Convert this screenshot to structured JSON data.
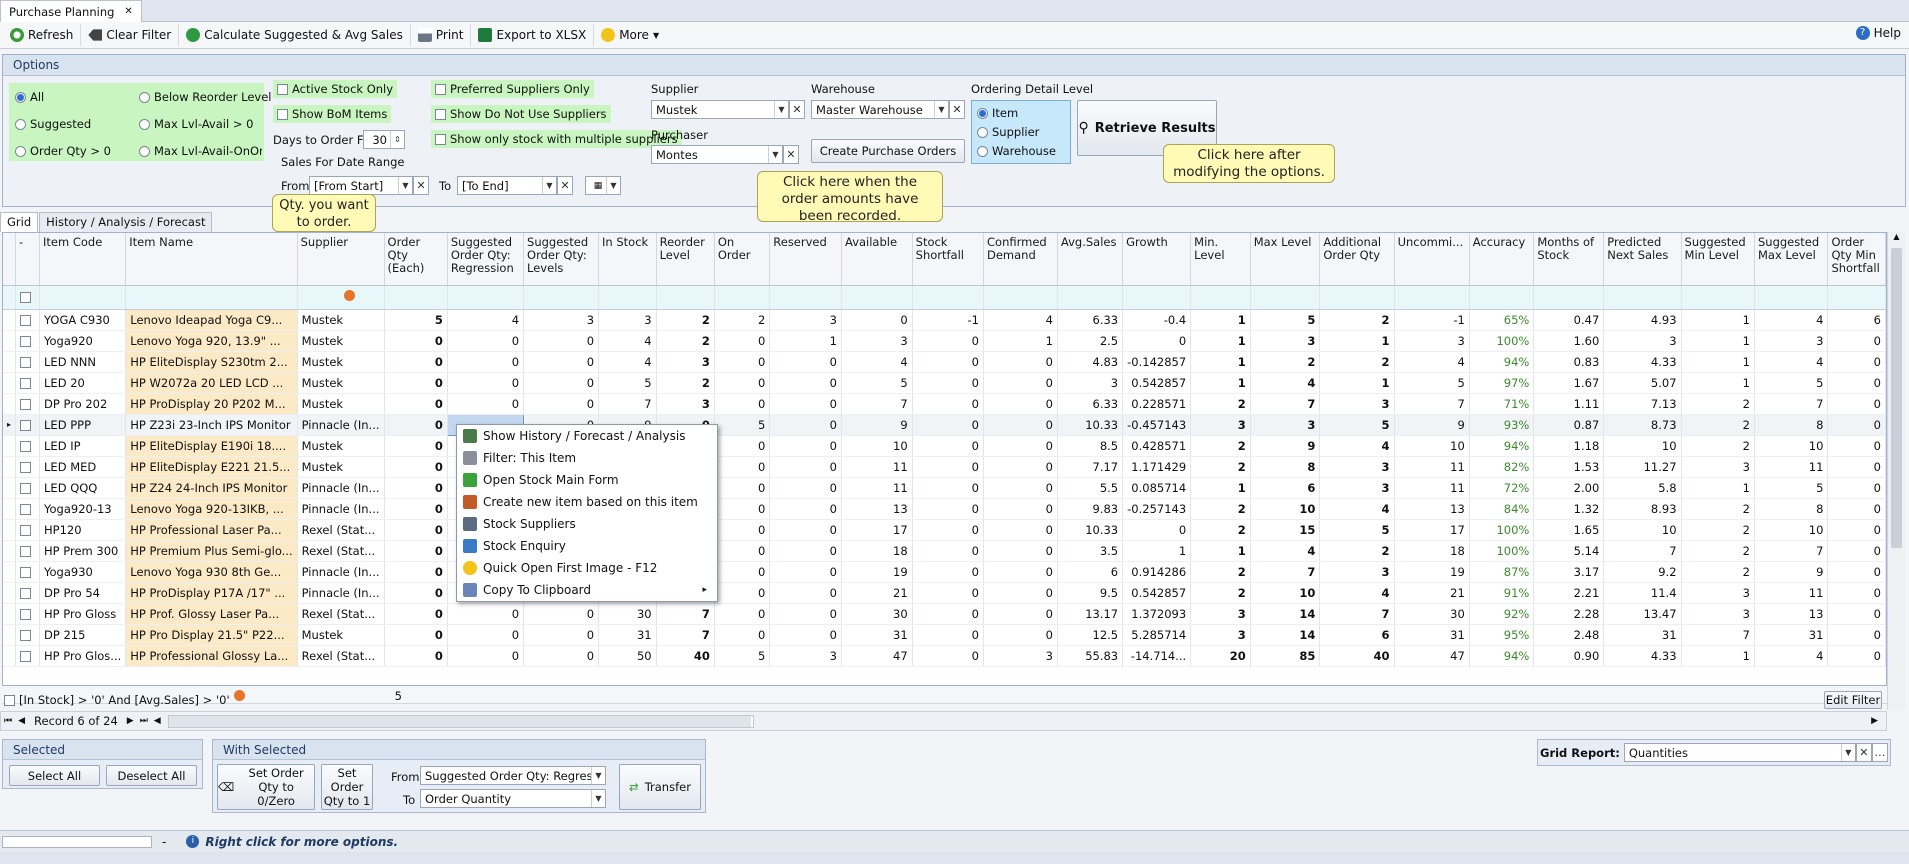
{
  "window": {
    "tab_title": "Purchase Planning",
    "close": "✕"
  },
  "toolbar": {
    "refresh": "Refresh",
    "clear_filter": "Clear Filter",
    "calculate": "Calculate Suggested & Avg Sales",
    "print": "Print",
    "export": "Export to XLSX",
    "more": "More",
    "help": "Help"
  },
  "options": {
    "title": "Options",
    "radio_all": "All",
    "radio_suggested": "Suggested",
    "radio_orderqty": "Order Qty > 0",
    "radio_below": "Below Reorder Level",
    "radio_maxlvl": "Max Lvl-Avail > 0",
    "radio_maxlvl_onorder": "Max Lvl-Avail-OnOrder",
    "active_stock": "Active Stock Only",
    "show_bom": "Show BoM Items",
    "preferred_suppliers": "Preferred Suppliers Only",
    "do_not_use": "Show Do Not Use Suppliers",
    "multiple_suppliers": "Show only stock with multiple suppliers",
    "days_label": "Days to Order For",
    "days_value": "30",
    "sales_range": "Sales For Date Range",
    "from_label": "From",
    "from_value": "[From Start]",
    "to_label": "To",
    "to_value": "[To End]",
    "supplier_label": "Supplier",
    "supplier_value": "Mustek",
    "warehouse_label": "Warehouse",
    "warehouse_value": "Master Warehouse",
    "purchaser_label": "Purchaser",
    "purchaser_value": "Montes",
    "create_po": "Create Purchase Orders",
    "detail_label": "Ordering Detail Level",
    "detail_item": "Item",
    "detail_supplier": "Supplier",
    "detail_warehouse": "Warehouse",
    "retrieve": "Retrieve Results"
  },
  "callouts": {
    "retrieve": "Click here after modifying the options.",
    "create": "Click here when the order amounts have been recorded.",
    "qty": "Qty. you want to order."
  },
  "tabs": [
    "Grid",
    "History / Analysis / Forecast"
  ],
  "columns": [
    "-",
    "Item Code",
    "Item Name",
    "Supplier",
    "Order Qty (Each)",
    "Suggested Order Qty: Regression",
    "Suggested Order Qty: Levels",
    "In Stock",
    "Reorder Level",
    "On Order",
    "Reserved",
    "Available",
    "Stock Shortfall",
    "Confirmed Demand",
    "Avg.Sales",
    "Growth",
    "Min. Level",
    "Max Level",
    "Additional Order Qty",
    "Uncommi...",
    "Accuracy",
    "Months of Stock",
    "Predicted Next Sales",
    "Suggested Min Level",
    "Suggested Max Level",
    "Order Qty Min Shortfall"
  ],
  "rows": [
    {
      "code": "YOGA C930",
      "name": "Lenovo Ideapad Yoga C9...",
      "supplier": "Mustek",
      "v": [
        "5",
        "4",
        "3",
        "3",
        "2",
        "2",
        "3",
        "0",
        "-1",
        "4",
        "6.33",
        "-0.4",
        "1",
        "5",
        "2",
        "-1",
        "65%",
        "0.47",
        "4.93",
        "1",
        "4",
        "6"
      ]
    },
    {
      "code": "Yoga920",
      "name": "Lenovo Yoga 920, 13.9\" ...",
      "supplier": "Mustek",
      "v": [
        "0",
        "0",
        "0",
        "4",
        "2",
        "0",
        "1",
        "3",
        "0",
        "1",
        "2.5",
        "0",
        "1",
        "3",
        "1",
        "3",
        "100%",
        "1.60",
        "3",
        "1",
        "3",
        "0"
      ]
    },
    {
      "code": "LED NNN",
      "name": "HP EliteDisplay S230tm 2...",
      "supplier": "Mustek",
      "v": [
        "0",
        "0",
        "0",
        "4",
        "3",
        "0",
        "0",
        "4",
        "0",
        "0",
        "4.83",
        "-0.142857",
        "1",
        "2",
        "2",
        "4",
        "94%",
        "0.83",
        "4.33",
        "1",
        "4",
        "0"
      ]
    },
    {
      "code": "LED 20",
      "name": "HP W2072a 20 LED LCD ...",
      "supplier": "Mustek",
      "v": [
        "0",
        "0",
        "0",
        "5",
        "2",
        "0",
        "0",
        "5",
        "0",
        "0",
        "3",
        "0.542857",
        "1",
        "4",
        "1",
        "5",
        "97%",
        "1.67",
        "5.07",
        "1",
        "5",
        "0"
      ]
    },
    {
      "code": "DP Pro 202",
      "name": "HP ProDisplay 20 P202 M...",
      "supplier": "Mustek",
      "v": [
        "0",
        "0",
        "0",
        "7",
        "3",
        "0",
        "0",
        "7",
        "0",
        "0",
        "6.33",
        "0.228571",
        "2",
        "7",
        "3",
        "7",
        "71%",
        "1.11",
        "7.13",
        "2",
        "7",
        "0"
      ]
    },
    {
      "code": "LED PPP",
      "name": "HP Z23i 23-Inch IPS Monitor",
      "supplier": "Pinnacle (In...",
      "v": [
        "0",
        "",
        "0",
        "9",
        "0",
        "5",
        "0",
        "9",
        "0",
        "0",
        "10.33",
        "-0.457143",
        "3",
        "3",
        "5",
        "9",
        "93%",
        "0.87",
        "8.73",
        "2",
        "8",
        "0"
      ]
    },
    {
      "code": "LED IP",
      "name": "HP EliteDisplay E190i 18....",
      "supplier": "Mustek",
      "v": [
        "0",
        "",
        "",
        "",
        "",
        "0",
        "0",
        "10",
        "0",
        "0",
        "8.5",
        "0.428571",
        "2",
        "9",
        "4",
        "10",
        "94%",
        "1.18",
        "10",
        "2",
        "10",
        "0"
      ]
    },
    {
      "code": "LED MED",
      "name": "HP EliteDisplay E221 21.5...",
      "supplier": "Mustek",
      "v": [
        "0",
        "",
        "",
        "",
        "",
        "0",
        "0",
        "11",
        "0",
        "0",
        "7.17",
        "1.171429",
        "2",
        "8",
        "3",
        "11",
        "82%",
        "1.53",
        "11.27",
        "3",
        "11",
        "0"
      ]
    },
    {
      "code": "LED QQQ",
      "name": "HP Z24 24-Inch IPS Monitor",
      "supplier": "Pinnacle (In...",
      "v": [
        "0",
        "",
        "",
        "",
        "",
        "0",
        "0",
        "11",
        "0",
        "0",
        "5.5",
        "0.085714",
        "1",
        "6",
        "3",
        "11",
        "72%",
        "2.00",
        "5.8",
        "1",
        "5",
        "0"
      ]
    },
    {
      "code": "Yoga920-13",
      "name": "Lenovo Yoga 920-13IKB, ...",
      "supplier": "Pinnacle (In...",
      "v": [
        "0",
        "",
        "",
        "",
        "",
        "0",
        "0",
        "13",
        "0",
        "0",
        "9.83",
        "-0.257143",
        "2",
        "10",
        "4",
        "13",
        "84%",
        "1.32",
        "8.93",
        "2",
        "8",
        "0"
      ]
    },
    {
      "code": "HP120",
      "name": "HP Professional Laser Pa...",
      "supplier": "Rexel (Stat...",
      "v": [
        "0",
        "",
        "",
        "",
        "",
        "0",
        "0",
        "17",
        "0",
        "0",
        "10.33",
        "0",
        "2",
        "15",
        "5",
        "17",
        "100%",
        "1.65",
        "10",
        "2",
        "10",
        "0"
      ]
    },
    {
      "code": "HP Prem 300",
      "name": "HP Premium Plus Semi-glo...",
      "supplier": "Rexel (Stat...",
      "v": [
        "0",
        "",
        "",
        "",
        "",
        "0",
        "0",
        "18",
        "0",
        "0",
        "3.5",
        "1",
        "1",
        "4",
        "2",
        "18",
        "100%",
        "5.14",
        "7",
        "2",
        "7",
        "0"
      ]
    },
    {
      "code": "Yoga930",
      "name": "Lenovo Yoga 930 8th Ge...",
      "supplier": "Pinnacle (In...",
      "v": [
        "0",
        "",
        "",
        "",
        "",
        "0",
        "0",
        "19",
        "0",
        "0",
        "6",
        "0.914286",
        "2",
        "7",
        "3",
        "19",
        "87%",
        "3.17",
        "9.2",
        "2",
        "9",
        "0"
      ]
    },
    {
      "code": "DP Pro 54",
      "name": "HP ProDisplay P17A /17\" ...",
      "supplier": "Pinnacle (In...",
      "v": [
        "0",
        "",
        "",
        "",
        "",
        "0",
        "0",
        "21",
        "0",
        "0",
        "9.5",
        "0.542857",
        "2",
        "10",
        "4",
        "21",
        "91%",
        "2.21",
        "11.4",
        "3",
        "11",
        "0"
      ]
    },
    {
      "code": "HP Pro Gloss",
      "name": "HP Prof. Glossy Laser Pa...",
      "supplier": "Rexel (Stat...",
      "v": [
        "0",
        "0",
        "0",
        "30",
        "7",
        "0",
        "0",
        "30",
        "0",
        "0",
        "13.17",
        "1.372093",
        "3",
        "14",
        "7",
        "30",
        "92%",
        "2.28",
        "13.47",
        "3",
        "13",
        "0"
      ]
    },
    {
      "code": "DP 215",
      "name": "HP Pro Display 21.5\" P22...",
      "supplier": "Mustek",
      "v": [
        "0",
        "0",
        "0",
        "31",
        "7",
        "0",
        "0",
        "31",
        "0",
        "0",
        "12.5",
        "5.285714",
        "3",
        "14",
        "6",
        "31",
        "95%",
        "2.48",
        "31",
        "7",
        "31",
        "0"
      ]
    },
    {
      "code": "HP Pro Glos...",
      "name": "HP Professional Glossy La...",
      "supplier": "Rexel (Stat...",
      "v": [
        "0",
        "0",
        "0",
        "50",
        "40",
        "5",
        "3",
        "47",
        "0",
        "3",
        "55.83",
        "-14.714...",
        "20",
        "85",
        "40",
        "47",
        "94%",
        "0.90",
        "4.33",
        "1",
        "4",
        "0"
      ]
    }
  ],
  "footer_sum": "5",
  "context_menu": [
    "Show History / Forecast / Analysis",
    "Filter: This Item",
    "Open Stock Main Form",
    "Create new item based on this item",
    "Stock Suppliers",
    "Stock Enquiry",
    "Quick Open First Image - F12",
    "Copy To Clipboard"
  ],
  "filter_text": "[In Stock] > '0' And [Avg.Sales] > '0'",
  "edit_filter": "Edit Filter",
  "record_text": "Record 6 of 24",
  "selected": {
    "title": "Selected",
    "select_all": "Select All",
    "deselect_all": "Deselect All"
  },
  "with_selected": {
    "title": "With Selected",
    "set_zero": "Set Order Qty to 0/Zero",
    "set_one": "Set Order Qty to 1",
    "from_label": "From",
    "from_value": "Suggested Order Qty: Regression",
    "to_label": "To",
    "to_value": "Order Quantity",
    "transfer": "Transfer"
  },
  "grid_report": {
    "label": "Grid Report:",
    "value": "Quantities"
  },
  "status": {
    "hint": "Right click for more options.",
    "dash": "-"
  }
}
